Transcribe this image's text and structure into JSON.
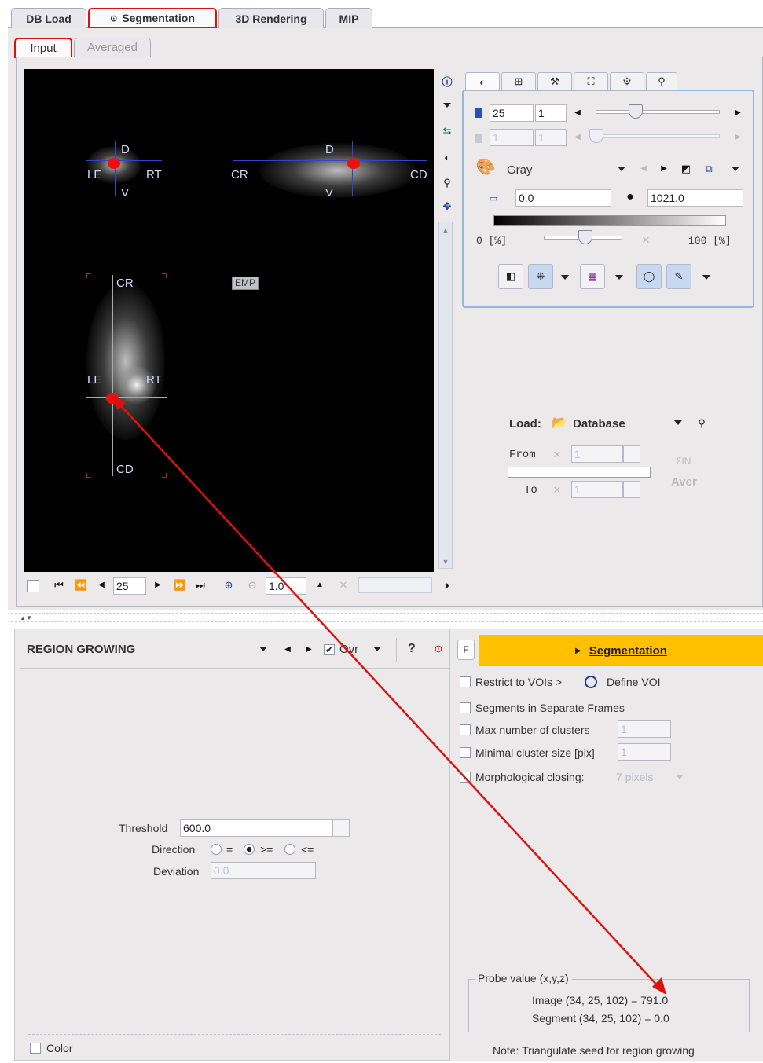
{
  "main_tabs": [
    "DB Load",
    "Segmentation",
    "3D Rendering",
    "MIP"
  ],
  "sub_tabs": [
    "Input",
    "Averaged"
  ],
  "viewer": {
    "orient": {
      "d": "D",
      "v": "V",
      "le": "LE",
      "rt": "RT",
      "cr": "CR",
      "cd": "CD"
    },
    "emp": "EMP",
    "nav": {
      "slice": "25",
      "zoom": "1.0"
    }
  },
  "color_panel": {
    "frame": "25",
    "frame2": "1",
    "frame_dis1": "1",
    "frame_dis2": "1",
    "lut": "Gray",
    "min": "0.0",
    "max": "1021.0",
    "pct_min": "0  [%]",
    "pct_max": "100  [%]"
  },
  "load": {
    "label": "Load:",
    "source": "Database",
    "from_label": "From",
    "to_label": "To",
    "from_value": "1",
    "to_value": "1",
    "sum_label": "ΣIN",
    "aver_label": "Aver"
  },
  "region": {
    "method": "REGION GROWING",
    "ovr": "Ovr",
    "help": "?",
    "f": "F",
    "segment_button": "Segmentation",
    "threshold_label": "Threshold",
    "threshold_value": "600.0",
    "direction_label": "Direction",
    "dir_eq": "=",
    "dir_ge": ">=",
    "dir_le": "<=",
    "deviation_label": "Deviation",
    "deviation_value": "0.0",
    "color_label": "Color"
  },
  "options": {
    "restrict": "Restrict to VOIs >",
    "define_voi": "Define VOI",
    "separate": "Segments in Separate Frames",
    "max_clusters": "Max number of clusters",
    "max_clusters_value": "1",
    "min_cluster": "Minimal cluster size [pix]",
    "min_cluster_value": "1",
    "morph": "Morphological closing:",
    "morph_value": "7 pixels"
  },
  "probe": {
    "title": "Probe value (x,y,z)",
    "image": "Image (34, 25, 102) = 791.0",
    "segment": "Segment (34, 25, 102) = 0.0"
  },
  "note": "Note: Triangulate seed for region growing",
  "colors": {
    "accent_yellow": "#ffc000",
    "highlight_red": "#e01010",
    "overlay_blue": "#3344cc"
  }
}
